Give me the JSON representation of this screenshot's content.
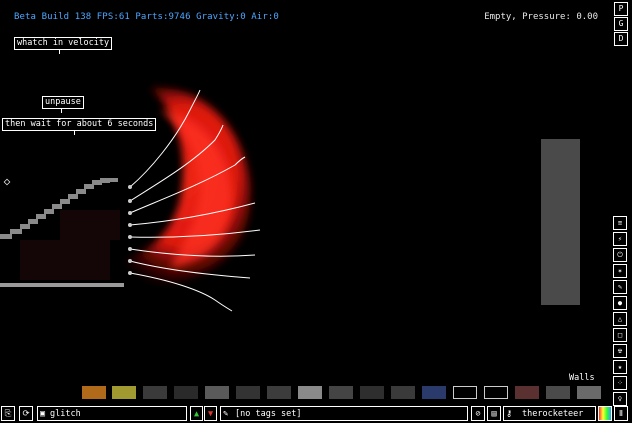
{
  "hud": {
    "status": "Beta Build 138 FPS:61 Parts:9746 Gravity:0 Air:0",
    "pressure": "Empty, Pressure: 0.00"
  },
  "notes": [
    {
      "text": "whatch in velocity"
    },
    {
      "text": "unpause"
    },
    {
      "text": "then wait for about 6 seconds"
    }
  ],
  "right_buttons": [
    "P",
    "G",
    "D"
  ],
  "category_label": "Walls",
  "tool_icons": [
    "console-icon",
    "plug-icon",
    "power-icon",
    "explosive-icon",
    "pen-icon",
    "drop-icon",
    "gas-icon",
    "box-icon",
    "radiation-icon",
    "star-icon",
    "dots-icon",
    "bulb-icon"
  ],
  "elements": [
    {
      "name": "element-swatch-1",
      "color": "#b06a1a"
    },
    {
      "name": "element-swatch-2",
      "color": "#a09a30"
    },
    {
      "name": "element-swatch-3",
      "color": "#3a3a3a"
    },
    {
      "name": "element-swatch-4",
      "color": "#2a2a2a"
    },
    {
      "name": "element-swatch-5",
      "color": "#5a5a5a"
    },
    {
      "name": "element-swatch-6",
      "color": "#333333"
    },
    {
      "name": "element-swatch-7",
      "color": "#3c3c3c"
    },
    {
      "name": "element-swatch-8",
      "color": "#8a8a8a"
    },
    {
      "name": "element-swatch-9",
      "color": "#444444"
    },
    {
      "name": "element-swatch-10",
      "color": "#2e2e2e"
    },
    {
      "name": "element-swatch-11",
      "color": "#3a3a3a"
    },
    {
      "name": "element-swatch-12",
      "color": "#2a3a6a"
    },
    {
      "name": "element-swatch-13",
      "color": "#000000"
    },
    {
      "name": "element-swatch-14",
      "color": "#000000"
    },
    {
      "name": "element-swatch-15",
      "color": "#5a3030"
    },
    {
      "name": "element-swatch-16",
      "color": "#4a4a4a"
    },
    {
      "name": "element-swatch-17",
      "color": "#6a6a6a"
    }
  ],
  "bottombar": {
    "save_name": "glitch",
    "tags": "[no tags set]",
    "username": "therocketeer"
  }
}
